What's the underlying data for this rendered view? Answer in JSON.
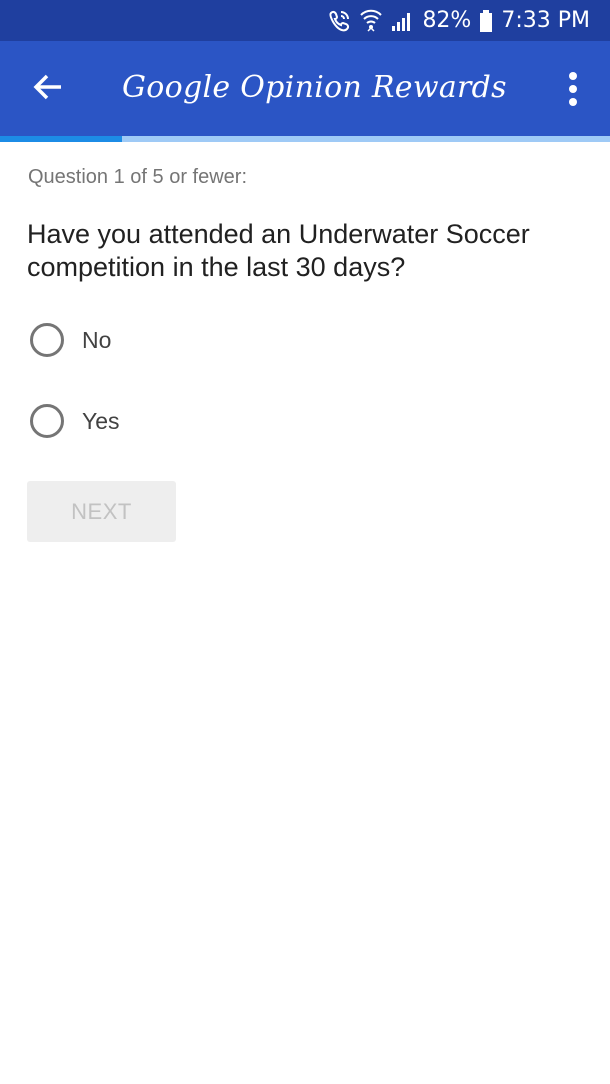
{
  "status_bar": {
    "battery_percent": "82%",
    "time": "7:33 PM",
    "icons": [
      "wifi-calling-icon",
      "wifi-icon",
      "signal-icon",
      "battery-icon"
    ]
  },
  "app_bar": {
    "title": "Google Opinion Rewards",
    "back_icon": "arrow-back-icon",
    "menu_icon": "more-vert-icon",
    "color": "#2b55c5"
  },
  "progress": {
    "fraction": 0.2,
    "fill_color": "#1c8ce6",
    "track_color": "#9fcaf6"
  },
  "survey": {
    "counter": "Question 1 of 5 or fewer:",
    "question": "Have you attended an Underwater Soccer competition in the last 30 days?",
    "options": [
      {
        "label": "No",
        "selected": false
      },
      {
        "label": "Yes",
        "selected": false
      }
    ],
    "next_label": "NEXT",
    "next_enabled": false
  }
}
